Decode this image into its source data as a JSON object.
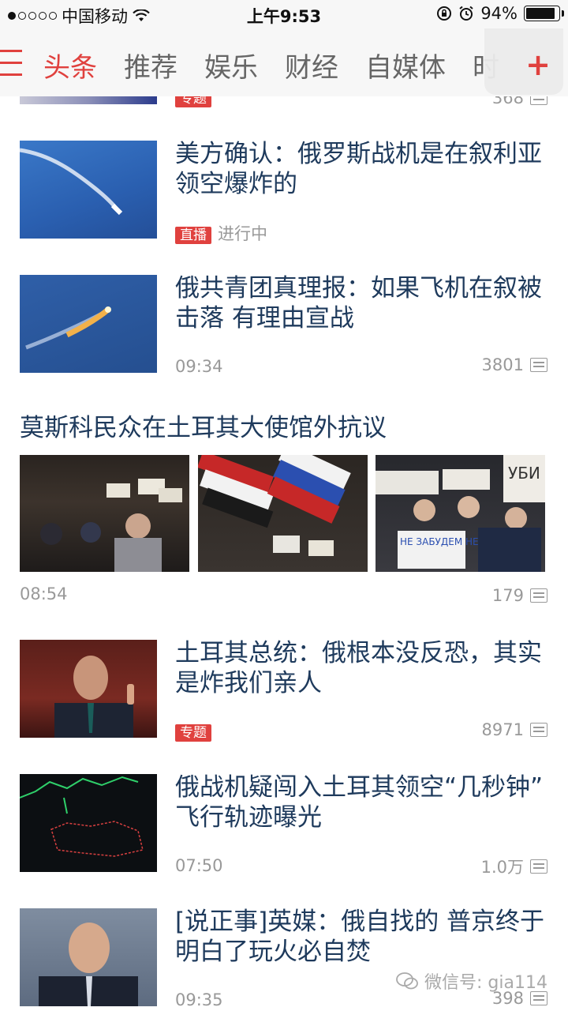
{
  "status_bar": {
    "carrier": "中国移动",
    "time": "上午9:53",
    "battery": "94%",
    "battery_level": 0.94
  },
  "nav": {
    "tabs": [
      {
        "label": "头条",
        "active": true
      },
      {
        "label": "推荐",
        "active": false
      },
      {
        "label": "娱乐",
        "active": false
      },
      {
        "label": "财经",
        "active": false
      },
      {
        "label": "自媒体",
        "active": false
      },
      {
        "label": "时",
        "active": false
      }
    ],
    "add_label": "+"
  },
  "prev_item": {
    "badge": "专题",
    "count": "368"
  },
  "news": [
    {
      "title": "美方确认：俄罗斯战机是在叙利亚领空爆炸的",
      "badge": "直播",
      "status": "进行中"
    },
    {
      "title": "俄共青团真理报：如果飞机在叙被击落 有理由宣战",
      "time": "09:34",
      "comments": "3801"
    },
    {
      "title": "莫斯科民众在土耳其大使馆外抗议",
      "time": "08:54",
      "comments": "179",
      "image_text_1": "УБИ",
      "image_text_2": "НЕ ЗАБУДЕМ НЕ ПРОСТИМ"
    },
    {
      "title": "土耳其总统：俄根本没反恐，其实是炸我们亲人",
      "badge": "专题",
      "comments": "8971"
    },
    {
      "title": "俄战机疑闯入土耳其领空“几秒钟” 飞行轨迹曝光",
      "time": "07:50",
      "comments": "1.0万"
    },
    {
      "title": "[说正事]英媒：俄自找的 普京终于明白了玩火必自焚",
      "time": "09:35",
      "comments": "398"
    }
  ],
  "watermark": "微信号: gia114",
  "colors": {
    "accent": "#e0413e",
    "title": "#1e3a5c",
    "meta": "#999999"
  }
}
